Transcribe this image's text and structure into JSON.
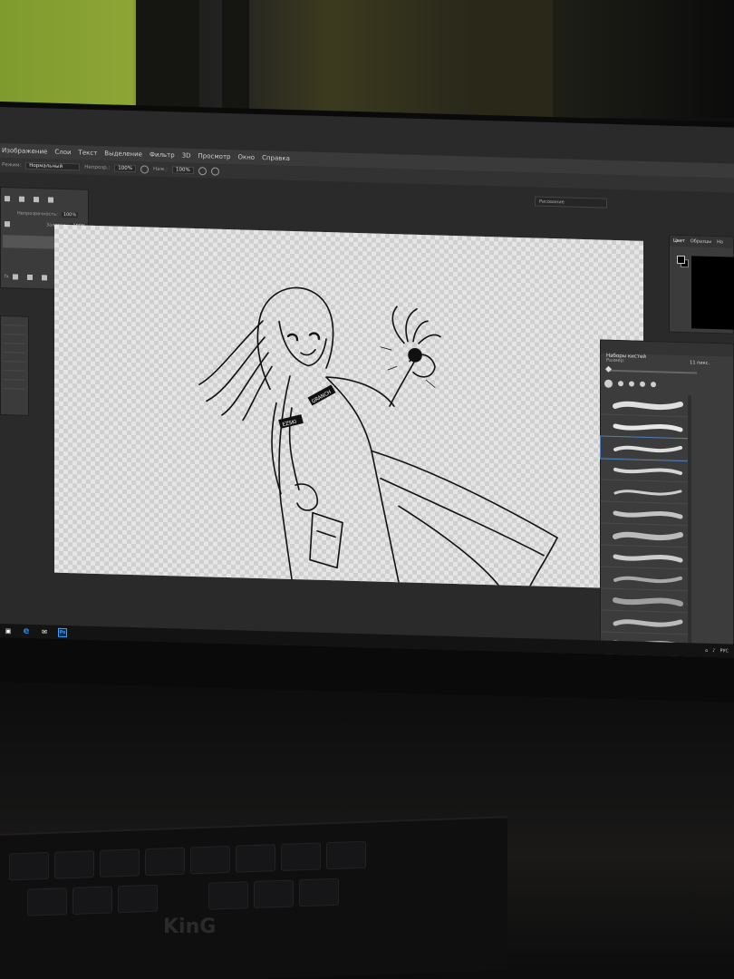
{
  "menu": {
    "items": [
      "Изображение",
      "Слои",
      "Текст",
      "Выделение",
      "Фильтр",
      "3D",
      "Просмотр",
      "Окно",
      "Справка"
    ]
  },
  "options": {
    "mode_label": "Режим:",
    "mode_value": "Нормальный",
    "opacity_label": "Непрозр.:",
    "opacity_value": "100%",
    "flow_label": "Наж.:",
    "flow_value": "100%"
  },
  "workspace": {
    "value": "Рисование"
  },
  "layers_panel": {
    "opacity_label": "Непрозрачность:",
    "opacity_value": "100%",
    "fill_label": "Заливка:",
    "fill_value": "100%",
    "footer": "fx"
  },
  "color_panel": {
    "tabs": [
      "Цвет",
      "Образцы",
      "На"
    ]
  },
  "brush_panel": {
    "title": "Наборы кистей",
    "size_label": "Размер:",
    "size_value": "11 пикс.",
    "strokes": [
      {
        "num": "",
        "width": 6,
        "opacity": 0.9
      },
      {
        "num": "",
        "width": 5,
        "opacity": 0.95
      },
      {
        "num": "",
        "width": 4,
        "opacity": 0.9
      },
      {
        "num": "",
        "width": 4,
        "opacity": 0.85
      },
      {
        "num": "",
        "width": 3,
        "opacity": 0.8
      },
      {
        "num": "",
        "width": 5,
        "opacity": 0.75
      },
      {
        "num": "",
        "width": 6,
        "opacity": 0.7
      },
      {
        "num": "",
        "width": 5,
        "opacity": 0.8
      },
      {
        "num": "",
        "width": 4,
        "opacity": 0.6
      },
      {
        "num": "",
        "width": 6,
        "opacity": 0.55
      },
      {
        "num": "",
        "width": 5,
        "opacity": 0.7
      },
      {
        "num": "",
        "width": 7,
        "opacity": 0.65
      }
    ]
  },
  "taskbar": {
    "ps_label": "Ps",
    "lang": "РУС"
  },
  "canvas": {
    "badge_left": "EZSKI",
    "badge_right": "GRANCH"
  },
  "keyboard_brand": "KinG"
}
